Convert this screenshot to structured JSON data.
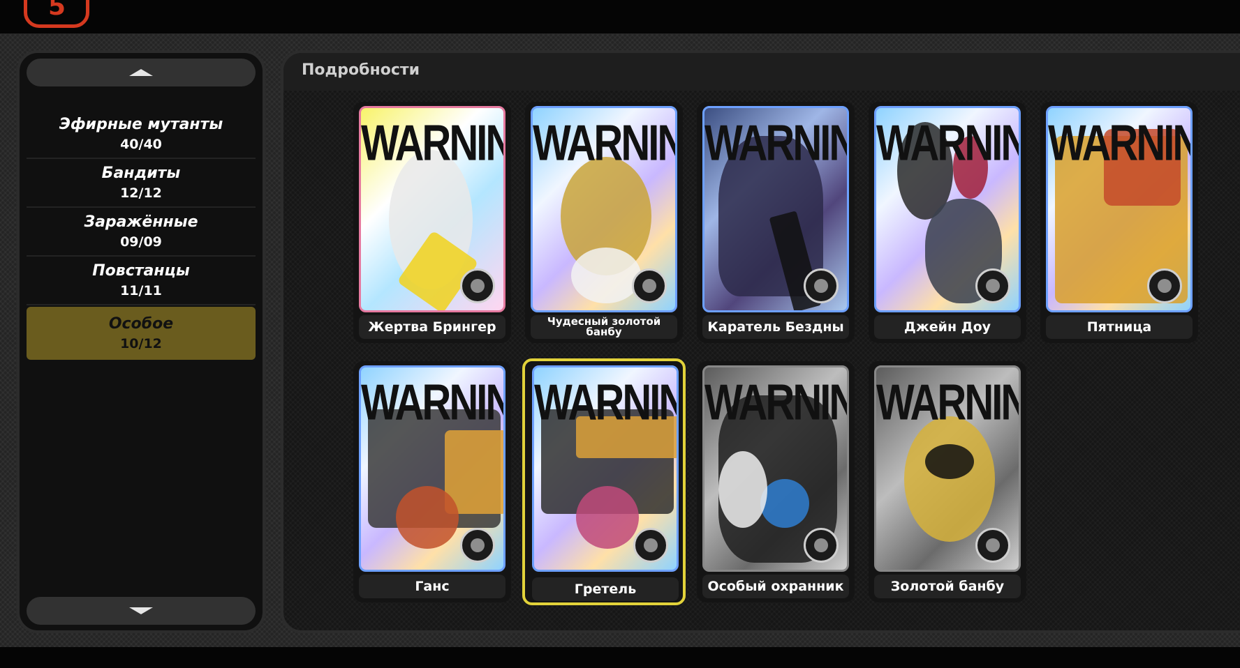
{
  "header": {
    "logo_glyph": "5"
  },
  "sidebar": {
    "categories": [
      {
        "name": "Эфирные мутанты",
        "count": "40/40"
      },
      {
        "name": "Бандиты",
        "count": "12/12"
      },
      {
        "name": "Заражённые",
        "count": "09/09"
      },
      {
        "name": "Повстанцы",
        "count": "11/11"
      },
      {
        "name": "Особое",
        "count": "10/12",
        "selected": true
      }
    ],
    "scroll_up_icon": "triangle-up",
    "scroll_down_icon": "triangle-down",
    "selected_color": "#6a5c1e"
  },
  "panel": {
    "title": "Подробности",
    "cards": [
      {
        "name": "Жертва Брингер",
        "warning": "WARNING",
        "badge": "sacrifice-badge"
      },
      {
        "name": "Чудесный золотой банбу",
        "warning": "WARNING",
        "badge": "machine-badge"
      },
      {
        "name": "Каратель Бездны",
        "warning": "WARNING",
        "badge": "organic-badge"
      },
      {
        "name": "Джейн Доу",
        "warning": "WARNING",
        "badge": "organic-badge"
      },
      {
        "name": "Пятница",
        "warning": "WARNING",
        "badge": "machine-badge"
      },
      {
        "name": "Ганс",
        "warning": "WARNING",
        "badge": "machine-badge"
      },
      {
        "name": "Гретель",
        "warning": "WARNING",
        "badge": "machine-badge",
        "selected": true
      },
      {
        "name": "Особый охранник",
        "warning": "WARNING",
        "badge": "organic-badge"
      },
      {
        "name": "Золотой банбу",
        "warning": "WARNING",
        "badge": "machine-badge"
      }
    ],
    "selected_border_color": "#e2d23a",
    "card_border_color": "#6da0ff"
  }
}
